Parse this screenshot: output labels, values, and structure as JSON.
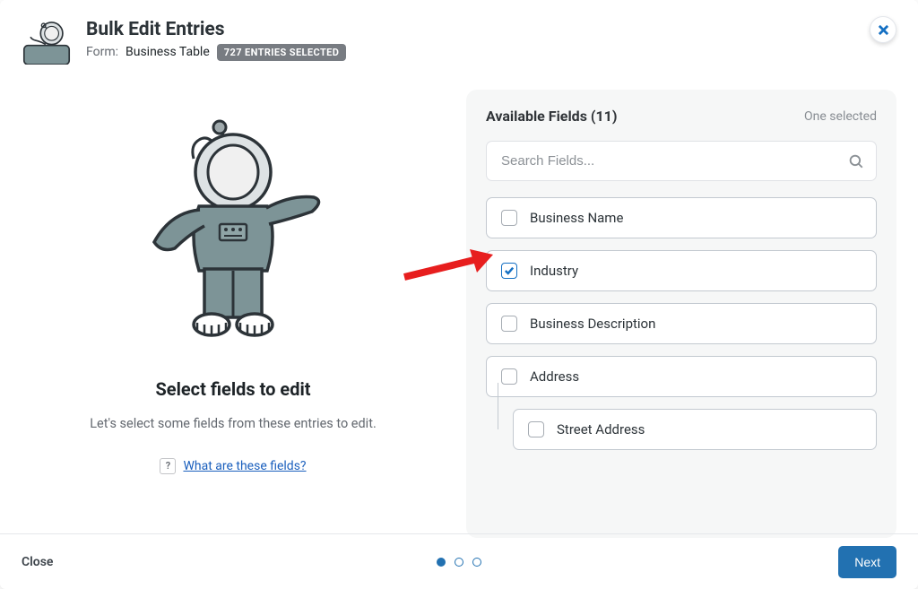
{
  "header": {
    "title": "Bulk Edit Entries",
    "form_label": "Form:",
    "form_name": "Business Table",
    "badge": "727 ENTRIES SELECTED"
  },
  "left": {
    "heading": "Select fields to edit",
    "description": "Let's select some fields from these entries to edit.",
    "help_q": "?",
    "help_link": "What are these fields?"
  },
  "panel": {
    "title": "Available Fields (11)",
    "selected": "One selected",
    "search_placeholder": "Search Fields..."
  },
  "fields": [
    {
      "label": "Business Name",
      "checked": false,
      "sub": false
    },
    {
      "label": "Industry",
      "checked": true,
      "sub": false
    },
    {
      "label": "Business Description",
      "checked": false,
      "sub": false
    },
    {
      "label": "Address",
      "checked": false,
      "sub": false
    },
    {
      "label": "Street Address",
      "checked": false,
      "sub": true
    }
  ],
  "footer": {
    "close": "Close",
    "next": "Next"
  }
}
